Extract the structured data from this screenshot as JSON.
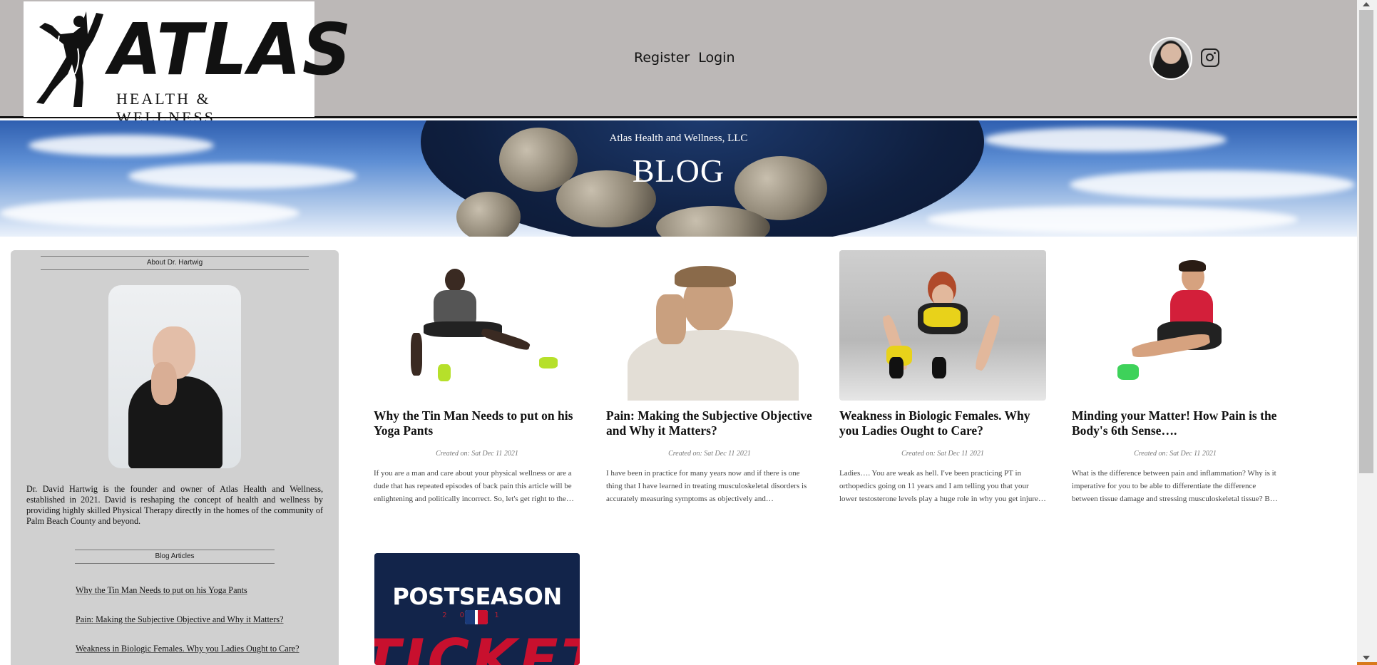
{
  "header": {
    "logo_text": "ATLAS",
    "logo_sub": "HEALTH & WELLNESS",
    "nav": [
      {
        "label": "Register"
      },
      {
        "label": "Login"
      }
    ]
  },
  "banner": {
    "subtitle": "Atlas Health and Wellness, LLC",
    "title": "BLOG"
  },
  "sidebar": {
    "about_heading": "About Dr. Hartwig",
    "bio": "Dr. David Hartwig is the founder and owner of Atlas Health and Wellness, established in 2021. David is reshaping the concept of health and wellness by providing highly skilled Physical Therapy directly in the homes of the community of Palm Beach County and beyond.",
    "articles_heading": "Blog Articles",
    "articles": [
      "Why the Tin Man Needs to put on his Yoga Pants",
      "Pain: Making the Subjective Objective and Why it Matters?",
      "Weakness in Biologic Females. Why you Ladies Ought to Care?"
    ]
  },
  "posts": [
    {
      "title": "Why the Tin Man Needs to put on his Yoga Pants",
      "date": "Created on: Sat Dec 11 2021",
      "excerpt": "If you are a man and care about your physical wellness or are a dude that has repeated episodes of back pain this article will be enlightening and politically incorrect. So, let's get right to the latter by me pointing out men are stronger than women are and that is a fact."
    },
    {
      "title": "Pain: Making the Subjective Objective and Why it Matters?",
      "date": "Created on: Sat Dec 11 2021",
      "excerpt": "I have been in practice for many years now and if there is one thing that I have learned in treating musculoskeletal disorders is accurately measuring symptoms as objectively and introspectively as possible. In fact, if you are a patient or a practicing PT and you understand this."
    },
    {
      "title": "Weakness in Biologic Females. Why you Ladies Ought to Care?",
      "date": "Created on: Sat Dec 11 2021",
      "excerpt": "Ladies…. You are weak as hell. I've been practicing PT in orthopedics going on 11 years and I am telling you that your lower testosterone levels play a huge role in why you get injured so often and why you absolutely hate to strength training as much as men do."
    },
    {
      "title": "Minding your Matter! How Pain is the Body's 6th Sense….",
      "date": "Created on: Sat Dec 11 2021",
      "excerpt": "What is the difference between pain and inflammation? Why is it imperative for you to be able to differentiate the difference between tissue damage and stressing musculoskeletal tissue? By stressing tissue, I am referring to soreness associated with resistance exercise."
    }
  ],
  "postseason": {
    "title": "POSTSEASON",
    "year": "2021",
    "big": "TICKETS"
  },
  "colors": {
    "header_bg": "#bcb8b7",
    "sidebar_bg": "#d0d0d0",
    "postseason_navy": "#12244a",
    "postseason_red": "#c8102e"
  },
  "icons": [
    "instagram-icon",
    "atlas-figure-logo"
  ]
}
